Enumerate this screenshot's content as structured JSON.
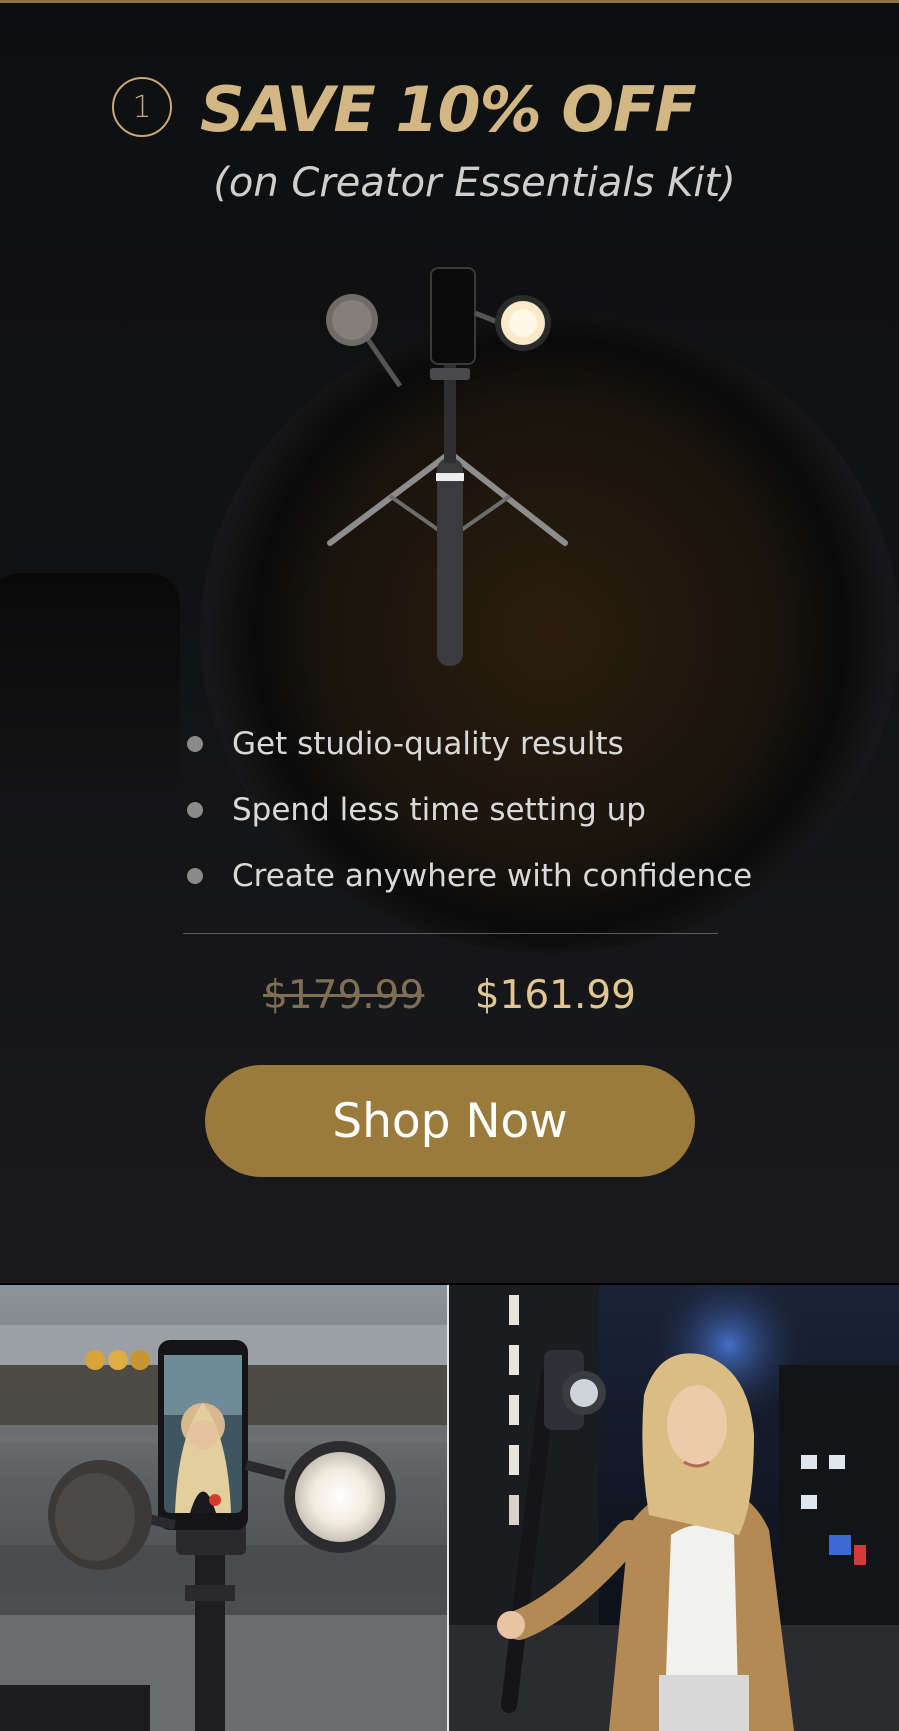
{
  "promo": {
    "step_number": "1",
    "title": "SAVE 10% OFF",
    "subtitle": "(on Creator Essentials Kit)"
  },
  "benefits": [
    "Get studio-quality results",
    "Spend less time setting up",
    "Create anywhere with confidence"
  ],
  "pricing": {
    "original": "$179.99",
    "sale": "$161.99"
  },
  "cta": {
    "label": "Shop Now"
  },
  "colors": {
    "accent_gold": "#c8a877",
    "button": "#9b7b3c",
    "background": "#0d0d0f"
  },
  "images": {
    "product": "creator-essentials-kit-tripod",
    "lifestyle_left": "phone-on-tripod-with-mic-and-light",
    "lifestyle_right": "woman-filming-at-night"
  }
}
